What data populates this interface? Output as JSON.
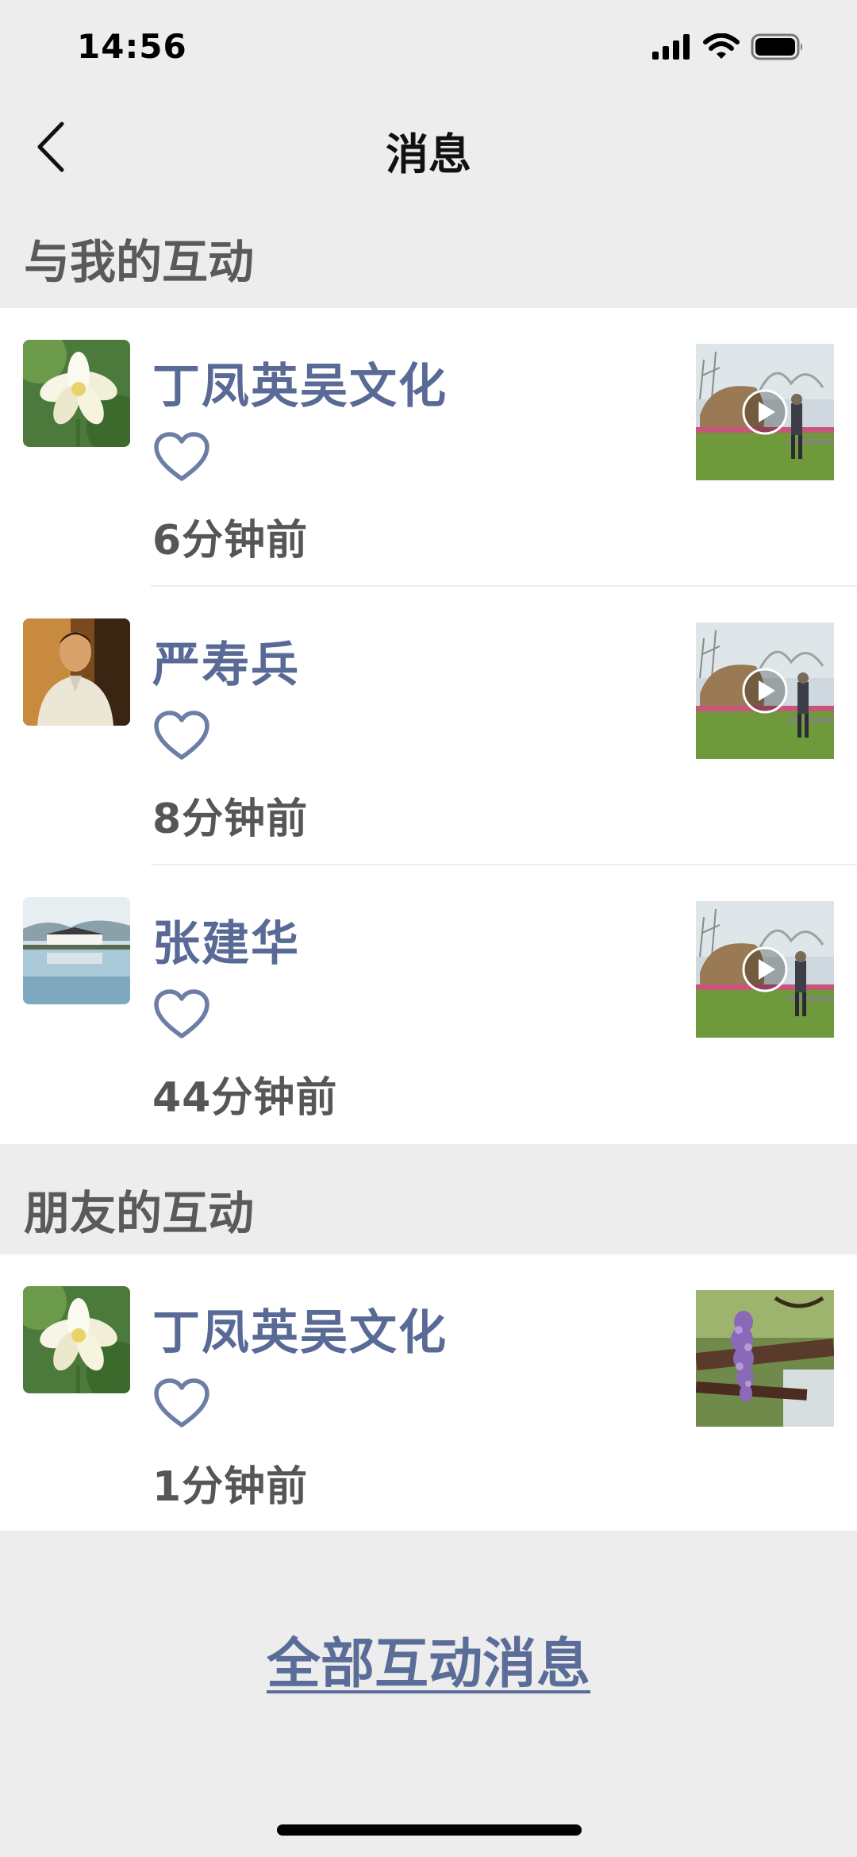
{
  "status_bar": {
    "time": "14:56"
  },
  "nav": {
    "title": "消息"
  },
  "sections": {
    "mine": {
      "title": "与我的互动"
    },
    "friends": {
      "title": "朋友的互动"
    }
  },
  "mine_items": [
    {
      "name": "丁凤英吴文化",
      "time": "6分钟前",
      "avatar": "lotus",
      "thumb": "video-garden"
    },
    {
      "name": "严寿兵",
      "time": "8分钟前",
      "avatar": "portrait",
      "thumb": "video-garden"
    },
    {
      "name": "张建华",
      "time": "44分钟前",
      "avatar": "lake",
      "thumb": "video-garden"
    }
  ],
  "friend_items": [
    {
      "name": "丁凤英吴文化",
      "time": "1分钟前",
      "avatar": "lotus",
      "thumb": "wisteria"
    }
  ],
  "footer": {
    "all_link": "全部互动消息"
  },
  "icons": {
    "back": "back-chevron-icon",
    "like": "heart-icon",
    "play": "play-icon"
  },
  "colors": {
    "name": "#586a95",
    "background": "#ededed",
    "card": "#ffffff"
  }
}
